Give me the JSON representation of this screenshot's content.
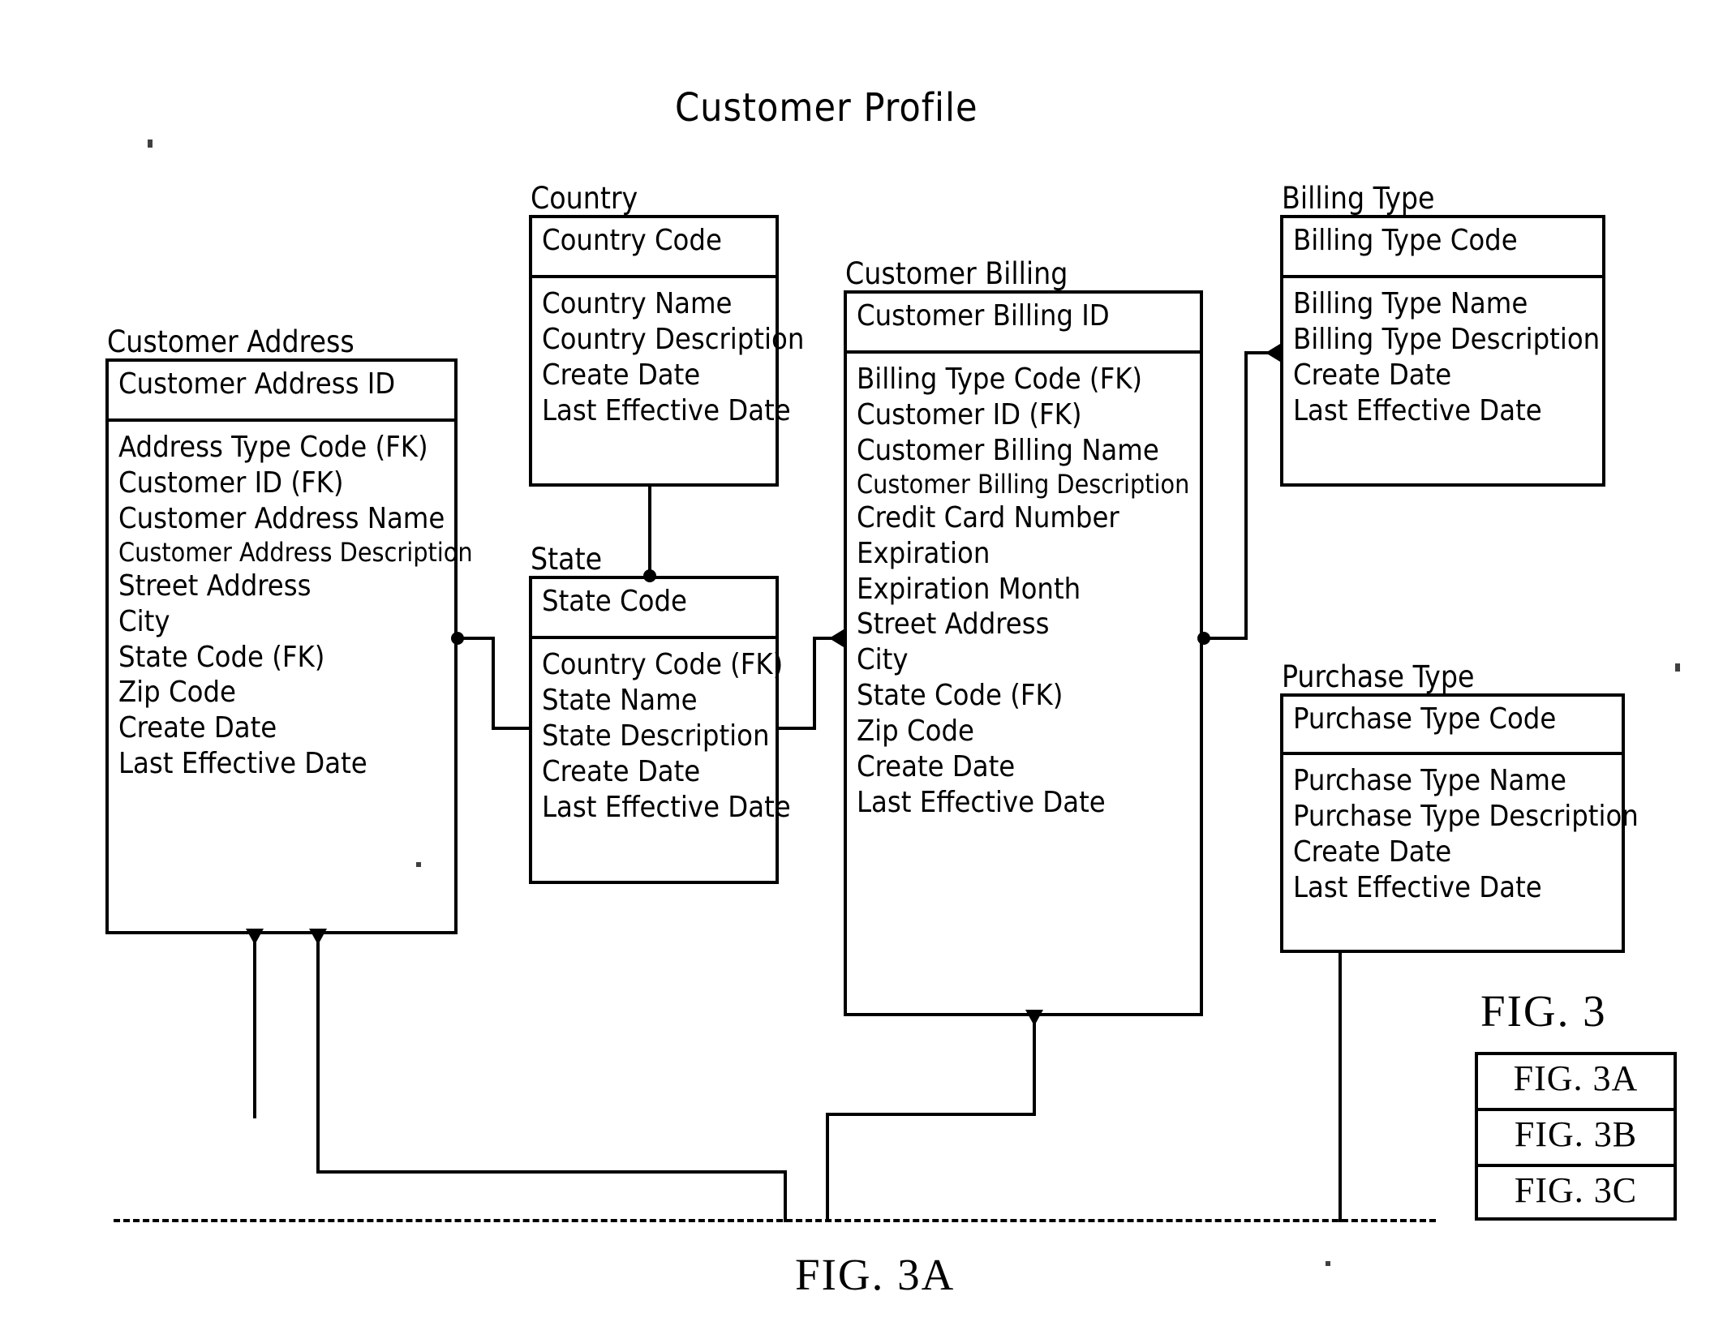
{
  "diagram": {
    "title": "Customer Profile",
    "bottom_caption": "FIG. 3A",
    "key_caption": "FIG. 3",
    "key_rows": [
      "FIG. 3A",
      "FIG. 3B",
      "FIG. 3C"
    ]
  },
  "entities": {
    "customer_address": {
      "label": "Customer Address",
      "primary_keys": [
        "Customer Address ID"
      ],
      "attributes": [
        "Address Type Code (FK)",
        "Customer ID (FK)",
        "Customer Address Name",
        "Customer Address Description",
        "Street Address",
        "City",
        "State Code (FK)",
        "Zip Code",
        "Create Date",
        "Last Effective Date"
      ]
    },
    "country": {
      "label": "Country",
      "primary_keys": [
        "Country Code"
      ],
      "attributes": [
        "Country Name",
        "Country Description",
        "Create Date",
        "Last Effective Date"
      ]
    },
    "state": {
      "label": "State",
      "primary_keys": [
        "State Code"
      ],
      "attributes": [
        "Country Code (FK)",
        "State Name",
        "State Description",
        "Create Date",
        "Last Effective Date"
      ]
    },
    "customer_billing": {
      "label": "Customer Billing",
      "primary_keys": [
        "Customer Billing ID"
      ],
      "attributes": [
        "Billing Type Code (FK)",
        "Customer ID (FK)",
        "Customer Billing Name",
        "Customer Billing Description",
        "Credit Card Number",
        "Expiration",
        "Expiration Month",
        "Street Address",
        "City",
        "State Code (FK)",
        "Zip Code",
        "Create Date",
        "Last Effective Date"
      ]
    },
    "billing_type": {
      "label": "Billing Type",
      "primary_keys": [
        "Billing Type Code"
      ],
      "attributes": [
        "Billing Type Name",
        "Billing Type Description",
        "Create Date",
        "Last Effective Date"
      ]
    },
    "purchase_type": {
      "label": "Purchase Type",
      "primary_keys": [
        "Purchase Type Code"
      ],
      "attributes": [
        "Purchase Type Name",
        "Purchase Type Description",
        "Create Date",
        "Last Effective Date"
      ]
    }
  },
  "colors": {
    "ink": "#000000",
    "paper": "#ffffff"
  }
}
